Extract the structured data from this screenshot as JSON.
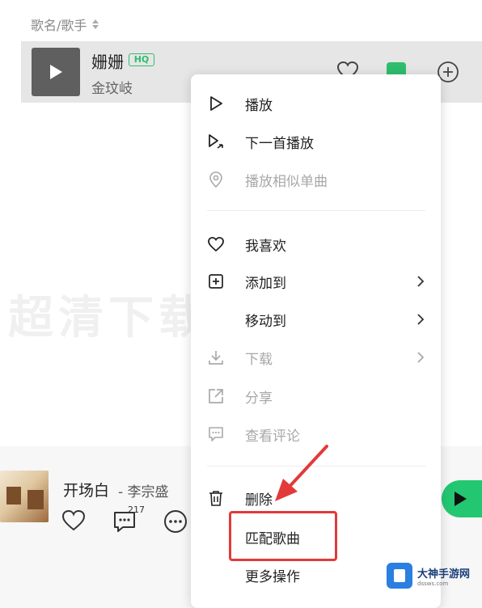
{
  "list": {
    "column_header": "歌名/歌手"
  },
  "song": {
    "title": "姗姗",
    "quality_badge": "HQ",
    "artist": "金玟岐"
  },
  "background_text": "超清下载",
  "player": {
    "now_playing_title": "开场白",
    "now_playing_artist": "- 李宗盛",
    "comment_count": "217"
  },
  "menu": {
    "items": [
      {
        "label": "播放",
        "icon": "play-outline-icon",
        "disabled": false
      },
      {
        "label": "下一首播放",
        "icon": "play-next-icon",
        "disabled": false
      },
      {
        "label": "播放相似单曲",
        "icon": "similar-radio-icon",
        "disabled": true
      },
      {
        "label": "我喜欢",
        "icon": "heart-icon",
        "disabled": false
      },
      {
        "label": "添加到",
        "icon": "add-square-icon",
        "disabled": false,
        "submenu": true
      },
      {
        "label": "移动到",
        "icon": "",
        "disabled": false,
        "submenu": true
      },
      {
        "label": "下载",
        "icon": "download-icon",
        "disabled": true,
        "submenu": true
      },
      {
        "label": "分享",
        "icon": "share-icon",
        "disabled": true
      },
      {
        "label": "查看评论",
        "icon": "comment-icon",
        "disabled": true
      },
      {
        "label": "删除",
        "icon": "trash-icon",
        "disabled": false
      },
      {
        "label": "匹配歌曲",
        "icon": "",
        "disabled": false
      },
      {
        "label": "更多操作",
        "icon": "",
        "disabled": false
      }
    ]
  },
  "watermark": {
    "title": "大神手游网",
    "url": "dssws.com"
  },
  "colors": {
    "accent_green": "#23c772",
    "annotation_red": "#e23a3a"
  }
}
